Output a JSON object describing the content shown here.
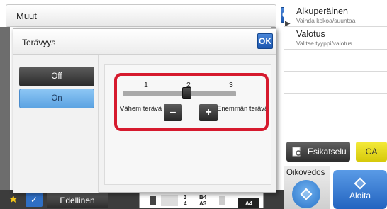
{
  "topbar": {
    "title": "Muut",
    "ok_label": "OK"
  },
  "side_panel": {
    "items": [
      {
        "title": "Alkuperäinen",
        "subtitle": "Vaihda kokoa/suuntaa"
      },
      {
        "title": "Valotus",
        "subtitle": "Valitse tyyppi/valotus"
      },
      {
        "title": "",
        "subtitle": ""
      },
      {
        "title": "",
        "subtitle": ""
      },
      {
        "title": "",
        "subtitle": ""
      }
    ],
    "preview_label": "Esikatselu",
    "ca_label": "CA",
    "proof_label": "Oikovedos",
    "start_label": "Aloita"
  },
  "bottom_bar": {
    "prev_label": "Edellinen",
    "tray": {
      "row1_num": "3",
      "row1_size": "B4",
      "row2_num": "4",
      "row2_size": "A3",
      "paper": "A4"
    }
  },
  "dialog": {
    "title": "Terävyys",
    "ok_label": "OK",
    "options": {
      "off_label": "Off",
      "on_label": "On",
      "selected": "On"
    },
    "slider": {
      "ticks": [
        "1",
        "2",
        "3"
      ],
      "value": 2,
      "min": 1,
      "max": 3,
      "less_label": "Vähem.terävä",
      "more_label": "Enemmän terävä",
      "minus_symbol": "–",
      "plus_symbol": "+"
    }
  },
  "colors": {
    "accent_blue": "#2364c0",
    "selected_option": "#6caee8",
    "highlight_red": "#d61a2e",
    "ca_yellow": "#e6da1c"
  }
}
